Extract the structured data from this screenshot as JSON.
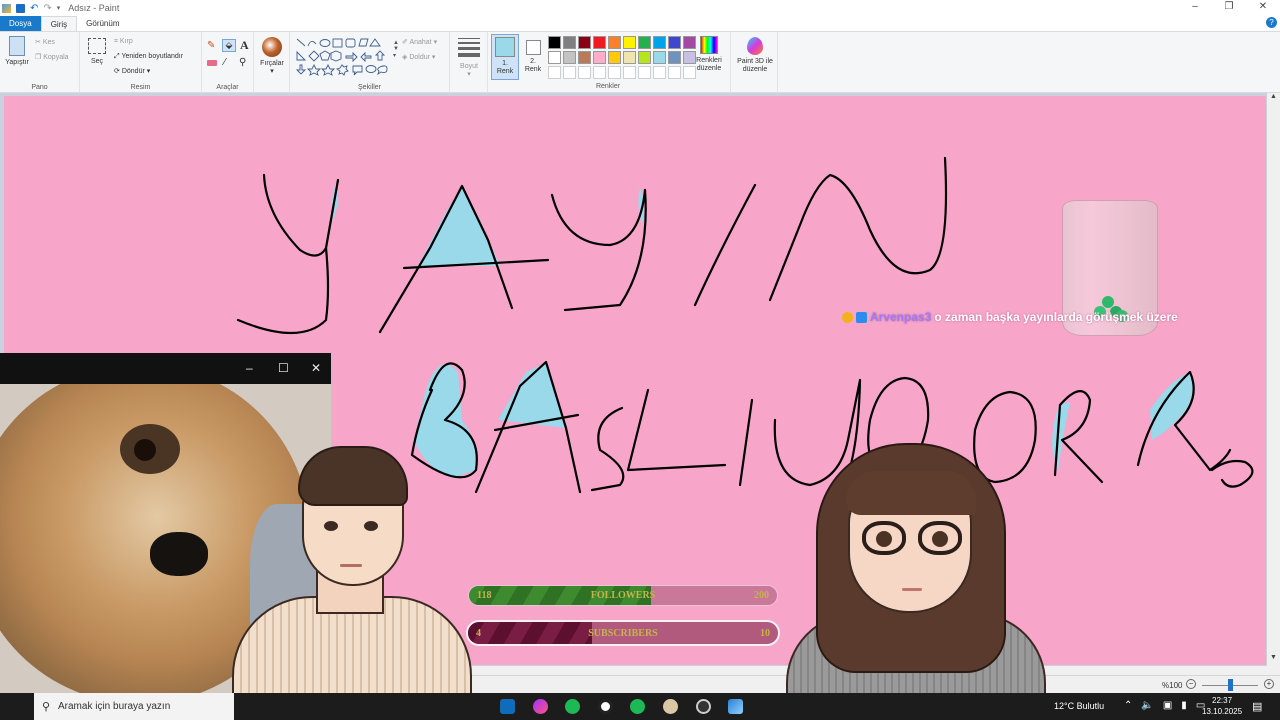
{
  "window": {
    "title": "Adsız - Paint",
    "tabs": [
      {
        "label": "Dosya"
      },
      {
        "label": "Giriş"
      },
      {
        "label": "Görünüm"
      }
    ]
  },
  "ribbon": {
    "clipboard": {
      "paste": "Yapıştır",
      "cut": "Kes",
      "copy": "Kopyala",
      "group": "Pano"
    },
    "image": {
      "select": "Seç",
      "crop": "Kırp",
      "resize": "Yeniden boyutlandır",
      "rotate": "Döndür",
      "group": "Resim"
    },
    "tools": {
      "group": "Araçlar"
    },
    "brushes": {
      "label": "Fırçalar"
    },
    "shapes": {
      "outline": "Anahat",
      "fill": "Doldur",
      "group": "Şekiller"
    },
    "size": {
      "label": "Boyut"
    },
    "colors": {
      "color1": "1.\nRenk",
      "color2": "2.\nRenk",
      "edit": "Renkleri düzenle",
      "paint3d": "Paint 3D ile düzenle",
      "group": "Renkler",
      "palette": [
        "#000000",
        "#7f7f7f",
        "#880015",
        "#ed1c24",
        "#ff7f27",
        "#fff200",
        "#22b14c",
        "#00a2e8",
        "#3f48cc",
        "#a349a4",
        "#ffffff",
        "#c3c3c3",
        "#b97a57",
        "#ffaec9",
        "#ffc90e",
        "#efe4b0",
        "#b5e61d",
        "#99d9ea",
        "#7092be",
        "#c8bfe7",
        "",
        "",
        "",
        "",
        "",
        "",
        "",
        "",
        "",
        ""
      ],
      "primary": "#99d9ea",
      "secondary": "#ffffff"
    }
  },
  "canvas": {
    "background": "#f7a6ca",
    "stroke": "#000000",
    "fill": "#99d9ea"
  },
  "chat": {
    "user": "Arvenpas3",
    "message": "o zaman başka yayınlarda görüşmek üzere",
    "hidden_part": "görüşmek ü"
  },
  "goals": {
    "followers": {
      "current": "118",
      "label": "FOLLOWERS",
      "target": "200",
      "fraction": 0.59
    },
    "subscribers": {
      "current": "4",
      "label": "SUBSCRIBERS",
      "target": "10",
      "fraction": 0.4
    }
  },
  "camera": {
    "min": "–",
    "max": "☐",
    "close": "✕"
  },
  "status": {
    "zoom": "%100",
    "minus": "−",
    "plus": "+"
  },
  "taskbar": {
    "search_placeholder": "Aramak için buraya yazın",
    "weather": "12°C  Bulutlu",
    "time": "22:37",
    "date": "13.10.2025"
  }
}
